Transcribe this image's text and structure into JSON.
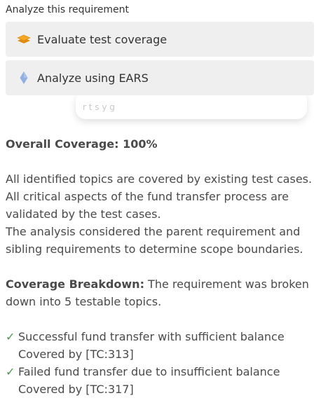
{
  "menu": {
    "title": "Analyze this requirement",
    "options": [
      {
        "label": "Evaluate test coverage",
        "icon": "layers-icon"
      },
      {
        "label": "Analyze using EARS",
        "icon": "diamond-icon"
      }
    ]
  },
  "background_card": {
    "text": "r         t     s   y   g"
  },
  "result": {
    "overall_label": "Overall Coverage: 100%",
    "summary_lines": [
      "All identified topics are covered by existing test cases.",
      "All critical aspects of the fund transfer process are",
      "validated by the test cases.",
      "The analysis considered the parent requirement and",
      "sibling requirements to determine scope boundaries."
    ],
    "breakdown_label": "Coverage Breakdown:",
    "breakdown_line1": " The requirement was broken",
    "breakdown_line2": "down into 5 testable topics.",
    "topics": [
      {
        "check": "✓",
        "title": "Successful fund transfer with sufficient balance",
        "covered": "Covered by [TC:313]"
      },
      {
        "check": "✓",
        "title": "Failed fund transfer due to insufficient balance",
        "covered": "Covered by [TC:317]"
      }
    ]
  },
  "colors": {
    "option_bg": "#efefef",
    "check": "#4a9a4a",
    "layers_icon": "#f5a623",
    "diamond_icon": "#8fb0e0"
  }
}
